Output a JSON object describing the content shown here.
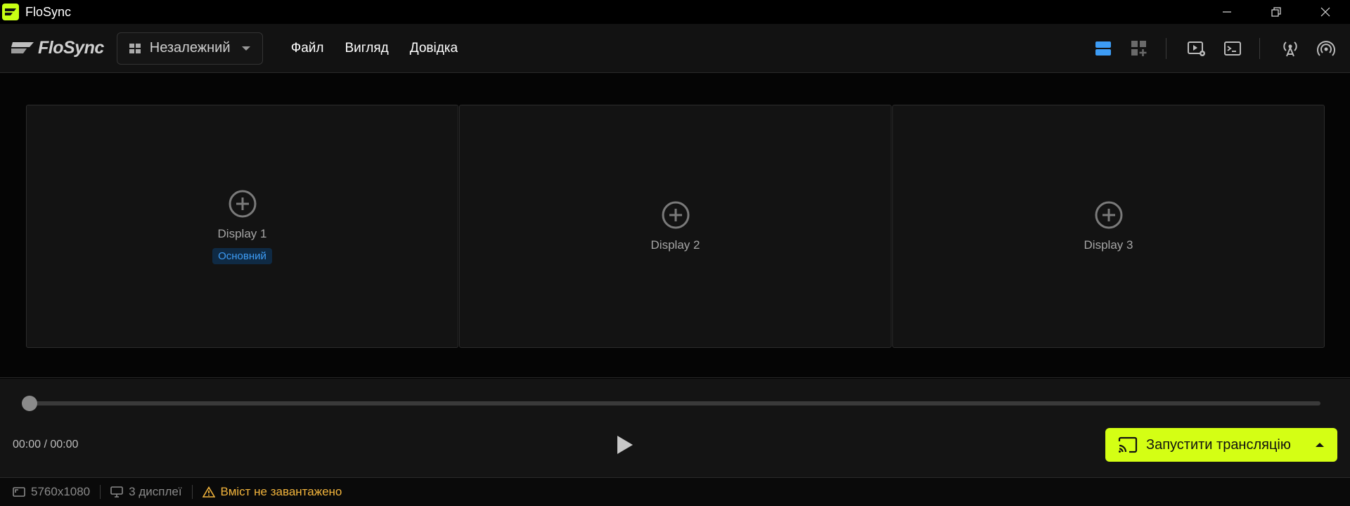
{
  "window": {
    "title": "FloSync"
  },
  "header": {
    "brand": "FloSync",
    "mode_select": "Незалежний",
    "menu": [
      "Файл",
      "Вигляд",
      "Довідка"
    ],
    "toolbar": [
      "layout-rows-icon",
      "layout-grid-add-icon",
      "video-settings-icon",
      "terminal-icon",
      "antenna-icon",
      "broadcast-icon"
    ],
    "accent_color": "#3d9cf5"
  },
  "displays": [
    {
      "name": "Display 1",
      "badge": "Основний"
    },
    {
      "name": "Display 2"
    },
    {
      "name": "Display 3"
    }
  ],
  "player": {
    "time": "00:00 / 00:00",
    "progress": 0,
    "broadcast_label": "Запустити трансляцію",
    "broadcast_color": "#d4ff14"
  },
  "status": {
    "resolution": "5760x1080",
    "display_count": "3 дисплеї",
    "warning": "Вміст не завантажено",
    "warning_color": "#f2b43c"
  }
}
